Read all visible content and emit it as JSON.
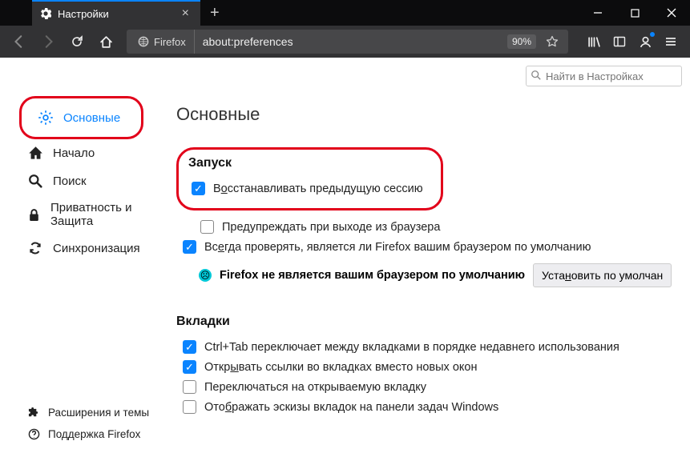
{
  "window": {
    "tab_title": "Настройки"
  },
  "toolbar": {
    "identity_label": "Firefox",
    "url": "about:preferences",
    "zoom": "90%"
  },
  "find": {
    "placeholder": "Найти в Настройках"
  },
  "sidebar": {
    "general": "Основные",
    "home": "Начало",
    "search": "Поиск",
    "privacy": "Приватность и Защита",
    "sync": "Синхронизация",
    "extensions": "Расширения и темы",
    "support": "Поддержка Firefox"
  },
  "main": {
    "heading": "Основные",
    "launch": {
      "title": "Запуск",
      "restore": "Восстанавливать предыдущую сессию",
      "warn_quit": "Предупреждать при выходе из браузера",
      "always_check": "Всегда проверять, является ли Firefox вашим браузером по умолчанию",
      "not_default": "Firefox не является вашим браузером по умолчанию",
      "make_default": "Установить по умолчан"
    },
    "tabs": {
      "title": "Вкладки",
      "ctrl_tab": "Ctrl+Tab переключает между вкладками в порядке недавнего использования",
      "open_links": "Открывать ссылки во вкладках вместо новых окон",
      "switch_to": "Переключаться на открываемую вкладку",
      "previews": "Отображать эскизы вкладок на панели задач Windows"
    }
  },
  "u": {
    "restore_u": "о",
    "always_u": "е",
    "open_u": "ы",
    "make_u": "н",
    "previews_u": "б"
  }
}
